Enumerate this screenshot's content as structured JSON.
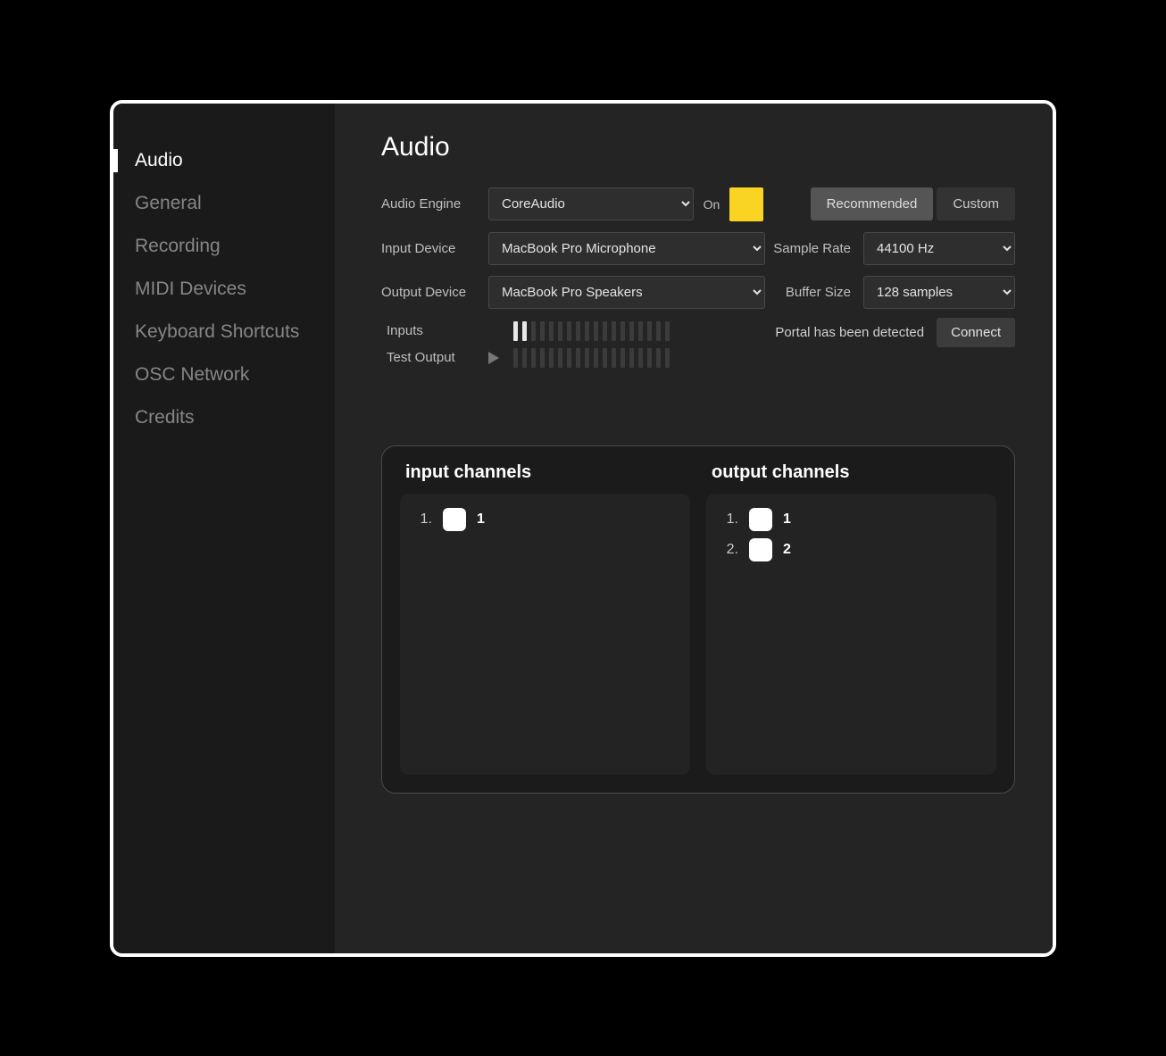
{
  "sidebar": {
    "items": [
      {
        "label": "Audio",
        "active": true
      },
      {
        "label": "General"
      },
      {
        "label": "Recording"
      },
      {
        "label": "MIDI Devices"
      },
      {
        "label": "Keyboard Shortcuts"
      },
      {
        "label": "OSC Network"
      },
      {
        "label": "Credits"
      }
    ]
  },
  "page": {
    "title": "Audio"
  },
  "form": {
    "audio_engine_label": "Audio Engine",
    "audio_engine_value": "CoreAudio",
    "on_label": "On",
    "input_device_label": "Input Device",
    "input_device_value": "MacBook Pro Microphone",
    "output_device_label": "Output Device",
    "output_device_value": "MacBook Pro Speakers",
    "sample_rate_label": "Sample Rate",
    "sample_rate_value": "44100 Hz",
    "buffer_size_label": "Buffer Size",
    "buffer_size_value": "128 samples",
    "recommended_label": "Recommended",
    "custom_label": "Custom"
  },
  "meters": {
    "inputs_label": "Inputs",
    "test_output_label": "Test Output",
    "input_level_bars": 2,
    "total_bars": 18
  },
  "portal": {
    "text": "Portal has been detected",
    "connect_label": "Connect"
  },
  "channels": {
    "input_header": "input channels",
    "output_header": "output channels",
    "inputs": [
      {
        "index": "1.",
        "name": "1",
        "on": true
      }
    ],
    "outputs": [
      {
        "index": "1.",
        "name": "1",
        "on": true
      },
      {
        "index": "2.",
        "name": "2",
        "on": true
      }
    ]
  }
}
